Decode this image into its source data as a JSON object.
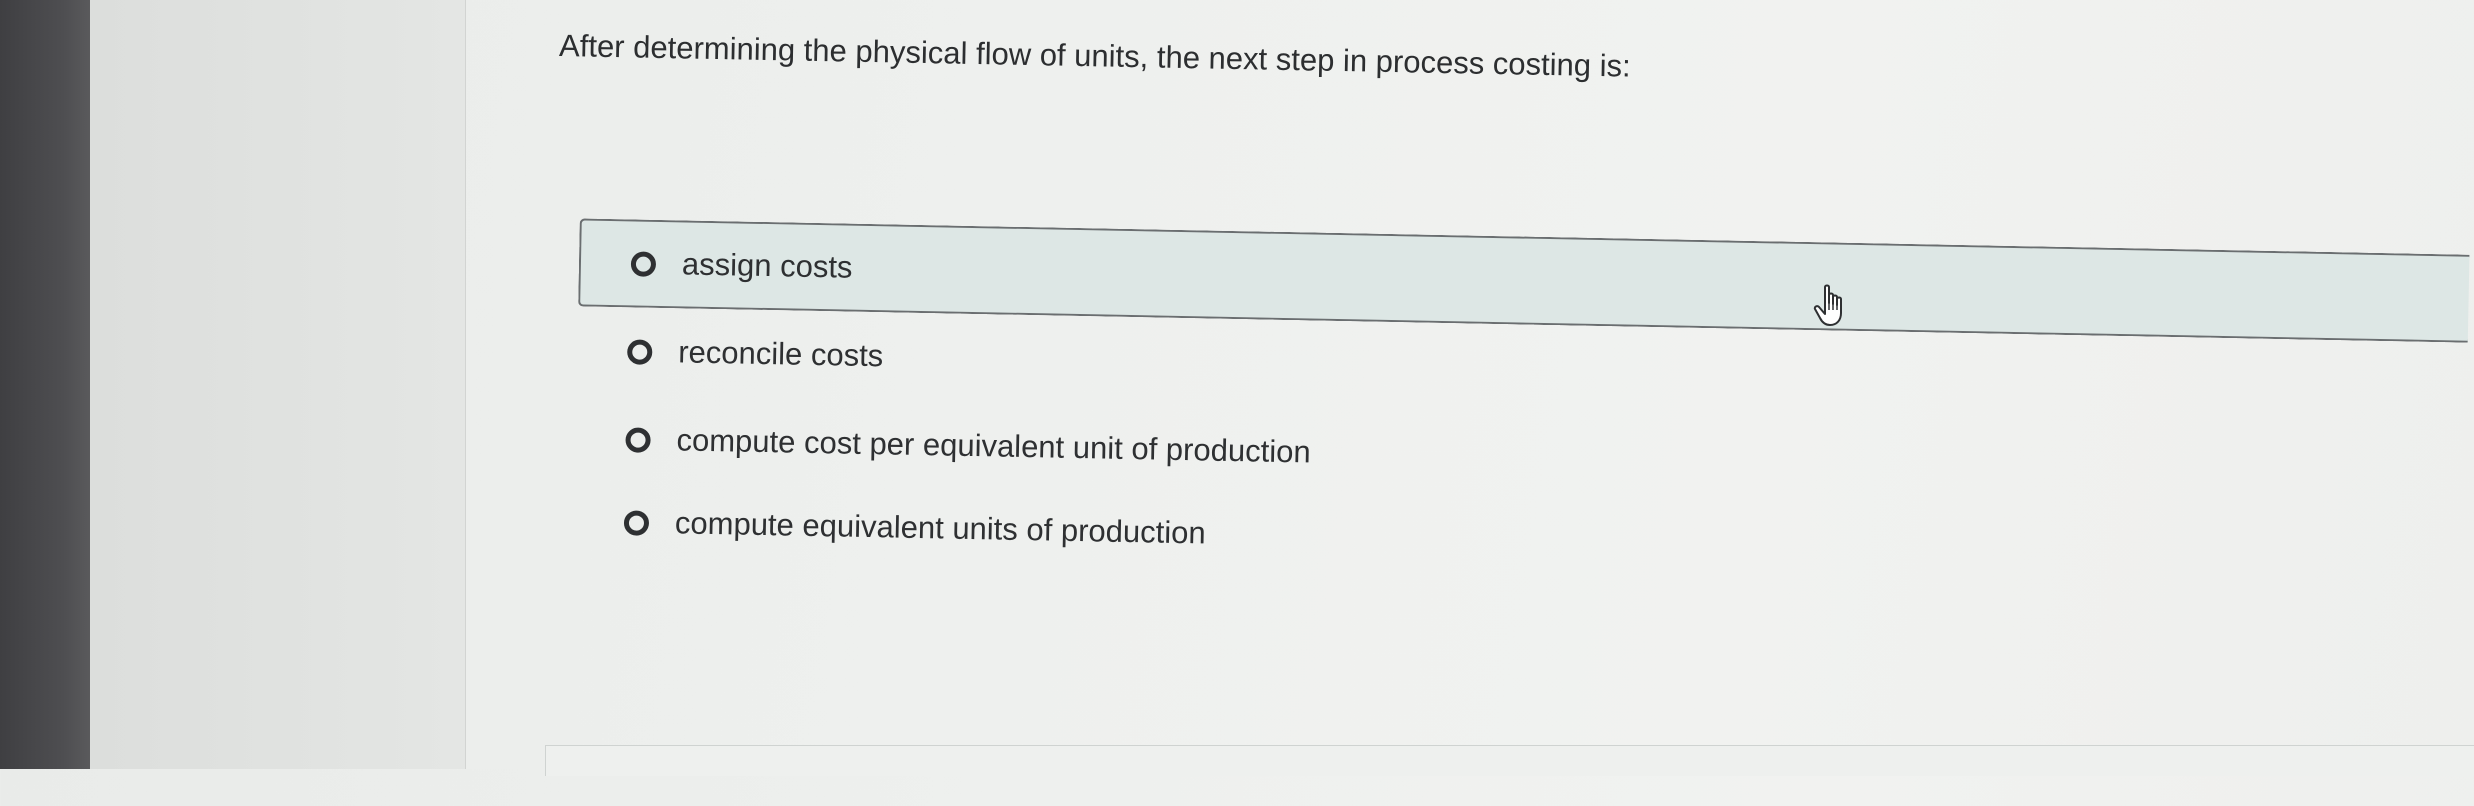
{
  "question": {
    "text": "After determining the physical flow of units, the next step in process costing is:"
  },
  "options": [
    {
      "label": "assign costs",
      "selected": true
    },
    {
      "label": "reconcile costs",
      "selected": false
    },
    {
      "label": "compute cost per equivalent unit of production",
      "selected": false
    },
    {
      "label": "compute equivalent units of production",
      "selected": false
    }
  ],
  "cursor": {
    "icon": "hand-pointer-icon"
  },
  "colors": {
    "selected_background": "#dde7e5",
    "selected_border": "#6a6e70",
    "text": "#2e3032"
  }
}
